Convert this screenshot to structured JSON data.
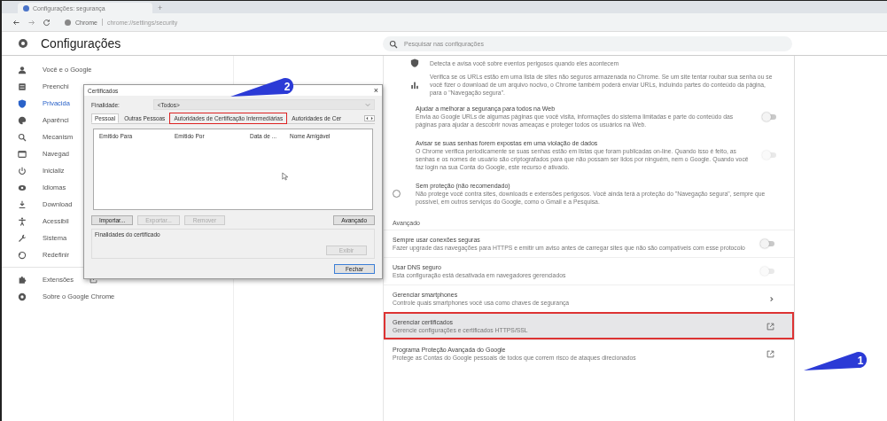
{
  "browser": {
    "tab_title": "Configurações: segurança",
    "new_tab": "+",
    "address": {
      "site": "Chrome",
      "url": "chrome://settings/security"
    }
  },
  "header": {
    "title": "Configurações",
    "search": {
      "placeholder": "Pesquisar nas configurações"
    }
  },
  "sidebar": {
    "items": [
      {
        "label": "Você e o Google",
        "selected": false
      },
      {
        "label": "Preenchi",
        "selected": false
      },
      {
        "label": "Privacida",
        "selected": true
      },
      {
        "label": "Aparênci",
        "selected": false
      },
      {
        "label": "Mecanism",
        "selected": false
      },
      {
        "label": "Navegad",
        "selected": false
      },
      {
        "label": "Inicializ",
        "selected": false
      },
      {
        "label": "Idiomas",
        "selected": false
      },
      {
        "label": "Download",
        "selected": false
      },
      {
        "label": "Acessibil",
        "selected": false
      },
      {
        "label": "Sistema",
        "selected": false
      },
      {
        "label": "Redefinir",
        "selected": false
      }
    ],
    "extra": [
      {
        "label": "Extensões",
        "external": true
      },
      {
        "label": "Sobre o Google Chrome",
        "external": false
      }
    ]
  },
  "main": {
    "intro": [
      {
        "text": "Detecta e avisa você sobre eventos perigosos quando eles acontecem"
      },
      {
        "text": "Verifica se os URLs estão em uma lista de sites não seguros armazenada no Chrome. Se um site tentar roubar sua senha ou se você fizer o download de um arquivo nocivo, o Chrome também poderá enviar URLs, incluindo partes do conteúdo da página, para o \"Navegação segura\"."
      }
    ],
    "rows": [
      {
        "kind": "toggle",
        "title": "Ajudar a melhorar a segurança para todos na Web",
        "text": "Envia ao Google URLs de algumas páginas que você visita, informações do sistema limitadas e parte do conteúdo das páginas para ajudar a descobrir novas ameaças e proteger todos os usuários na Web.",
        "on": false,
        "disabled": false
      },
      {
        "kind": "toggle",
        "title": "Avisar se suas senhas forem expostas em uma violação de dados",
        "text": "O Chrome verifica periodicamente se suas senhas estão em listas que foram publicadas on-line. Quando isso é feito, as senhas e os nomes de usuário são criptografados para que não possam ser lidos por ninguém, nem o Google. Quando você faz login na sua Conta do Google, este recurso é ativado.",
        "on": false,
        "disabled": true
      },
      {
        "kind": "radio",
        "title": "Sem proteção (não recomendado)",
        "text": "Não protege você contra sites, downloads e extensões perigosos. Você ainda terá a proteção do \"Navegação segura\", sempre que possível, em outros serviços do Google, como o Gmail e a Pesquisa.",
        "selected": false
      }
    ],
    "section": "Avançado",
    "advanced_rows": [
      {
        "kind": "toggle",
        "title": "Sempre usar conexões seguras",
        "text": "Fazer upgrade das navegações para HTTPS e emitir um aviso antes de carregar sites que não são compatíveis com esse protocolo",
        "on": false,
        "disabled": false,
        "highlighted": false
      },
      {
        "kind": "toggle",
        "title": "Usar DNS seguro",
        "text": "Esta configuração está desativada em navegadores gerenciados",
        "on": false,
        "disabled": true,
        "highlighted": false
      },
      {
        "kind": "arrow",
        "title": "Gerenciar smartphones",
        "text": "Controle quais smartphones você usa como chaves de segurança",
        "highlighted": false
      },
      {
        "kind": "external",
        "title": "Gerenciar certificados",
        "text": "Gerencie configurações e certificados HTTPS/SSL",
        "highlighted": true
      },
      {
        "kind": "external",
        "title": "Programa Proteção Avançada do Google",
        "text": "Protege as Contas do Google pessoais de todos que correm risco de ataques direcionados",
        "highlighted": false
      }
    ]
  },
  "dialog": {
    "title": "Certificados",
    "close": "×",
    "purpose_label": "Finalidade:",
    "purpose_value": "<Todos>",
    "tabs": [
      {
        "label": "Pessoal",
        "selected": true,
        "highlighted": false
      },
      {
        "label": "Outras Pessoas",
        "selected": false,
        "highlighted": false
      },
      {
        "label": "Autoridades de Certificação Intermediárias",
        "selected": false,
        "highlighted": true
      },
      {
        "label": "Autoridades de Cer",
        "selected": false,
        "highlighted": false
      }
    ],
    "columns": [
      "Emitido Para",
      "Emitido Por",
      "Data de ...",
      "Nome Amigável"
    ],
    "buttons": [
      {
        "label": "Importar...",
        "disabled": false
      },
      {
        "label": "Exportar...",
        "disabled": true
      },
      {
        "label": "Remover",
        "disabled": true
      }
    ],
    "advanced_button": "Avançado",
    "group_label": "Finalidades do certificado",
    "view_button": {
      "label": "Exibir",
      "disabled": true
    },
    "close_button": "Fechar"
  },
  "callouts": [
    {
      "number": "2"
    },
    {
      "number": "1"
    }
  ]
}
